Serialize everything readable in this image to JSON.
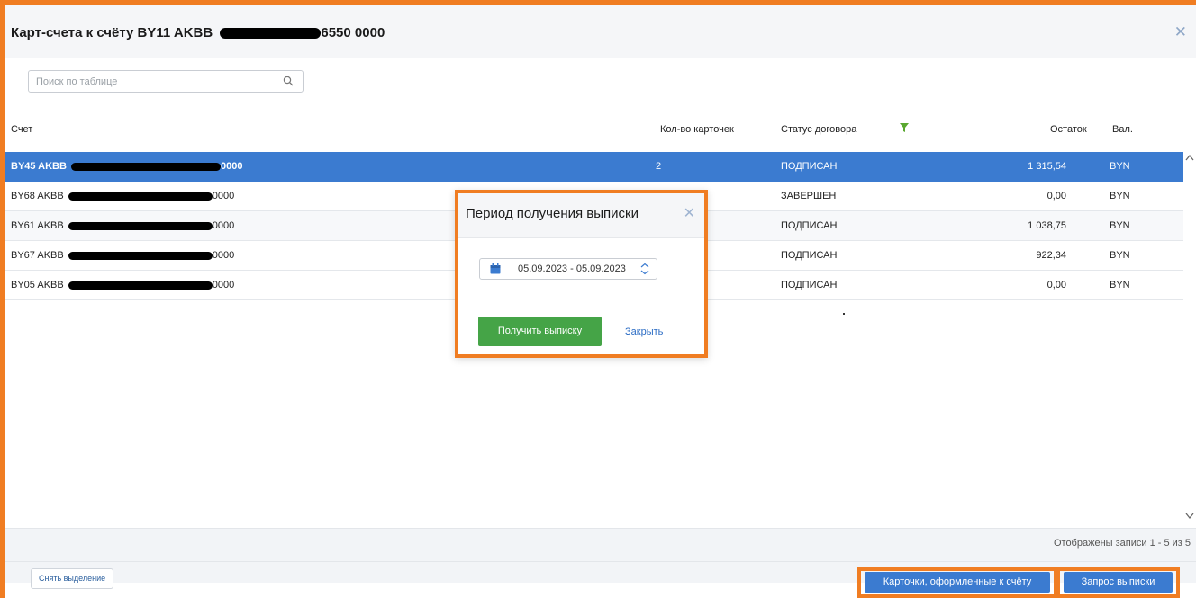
{
  "window": {
    "title_prefix": "Карт-счета к счёту BY11 AKBB",
    "title_suffix": "6550 0000",
    "close_glyph": "✕"
  },
  "search": {
    "placeholder": "Поиск по таблице",
    "value": ""
  },
  "columns": {
    "account": "Счет",
    "cards_count": "Кол-во карточек",
    "contract_status": "Статус договора",
    "balance": "Остаток",
    "currency": "Вал."
  },
  "rows": [
    {
      "acct_prefix": "BY45 AKBB",
      "acct_suffix": "0000",
      "cards": "2",
      "status": "ПОДПИСАН",
      "balance": "1 315,54",
      "currency": "BYN",
      "selected": true
    },
    {
      "acct_prefix": "BY68 AKBB",
      "acct_suffix": "0000",
      "cards": "",
      "status": "ЗАВЕРШЕН",
      "balance": "0,00",
      "currency": "BYN",
      "selected": false
    },
    {
      "acct_prefix": "BY61 AKBB",
      "acct_suffix": "0000",
      "cards": "",
      "status": "ПОДПИСАН",
      "balance": "1 038,75",
      "currency": "BYN",
      "selected": false
    },
    {
      "acct_prefix": "BY67 AKBB",
      "acct_suffix": "0000",
      "cards": "",
      "status": "ПОДПИСАН",
      "balance": "922,34",
      "currency": "BYN",
      "selected": false
    },
    {
      "acct_prefix": "BY05 AKBB",
      "acct_suffix": "0000",
      "cards": "",
      "status": "ПОДПИСАН",
      "balance": "0,00",
      "currency": "BYN",
      "selected": false
    }
  ],
  "footer": {
    "records_text": "Отображены записи 1 - 5 из 5",
    "clear_selection": "Снять выделение",
    "cards_button": "Карточки, оформленные к счёту",
    "statement_button": "Запрос выписки"
  },
  "modal": {
    "title": "Период получения выписки",
    "close_glyph": "✕",
    "date_range": "05.09.2023 - 05.09.2023",
    "get_button": "Получить выписку",
    "close_link": "Закрыть"
  },
  "colors": {
    "accent_orange": "#f07d22",
    "selected_row": "#3b7bd0",
    "green_button": "#45a447",
    "filter_icon": "#5aa830"
  }
}
